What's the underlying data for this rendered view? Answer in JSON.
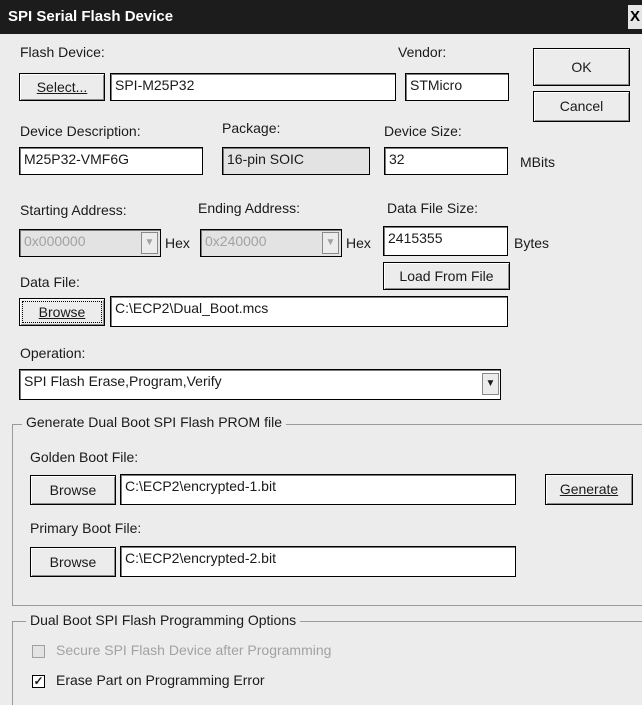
{
  "window": {
    "title": "SPI Serial Flash Device",
    "close_glyph": "X"
  },
  "buttons": {
    "ok": "OK",
    "cancel": "Cancel",
    "select": "Select...",
    "browse_data": "Browse",
    "load_from_file": "Load From File",
    "browse_golden": "Browse",
    "generate": "Generate",
    "browse_primary": "Browse"
  },
  "flash_device": {
    "label": "Flash Device:",
    "value": "SPI-M25P32"
  },
  "vendor": {
    "label": "Vendor:",
    "value": "STMicro"
  },
  "device_description": {
    "label": "Device Description:",
    "value": "M25P32-VMF6G"
  },
  "package": {
    "label": "Package:",
    "value": "16-pin SOIC"
  },
  "device_size": {
    "label": "Device Size:",
    "value": "32",
    "unit": "MBits"
  },
  "starting_address": {
    "label": "Starting Address:",
    "value": "0x000000",
    "suffix": "Hex"
  },
  "ending_address": {
    "label": "Ending Address:",
    "value": "0x240000",
    "suffix": "Hex"
  },
  "data_file_size": {
    "label": "Data File Size:",
    "value": "2415355",
    "unit": "Bytes"
  },
  "data_file": {
    "label": "Data File:",
    "value": "C:\\ECP2\\Dual_Boot.mcs"
  },
  "operation": {
    "label": "Operation:",
    "value": "SPI Flash Erase,Program,Verify"
  },
  "dual_boot_group": {
    "title": "Generate Dual Boot SPI Flash PROM file",
    "golden_label": "Golden Boot File:",
    "golden_value": "C:\\ECP2\\encrypted-1.bit",
    "primary_label": "Primary Boot File:",
    "primary_value": "C:\\ECP2\\encrypted-2.bit"
  },
  "options_group": {
    "title": "Dual Boot SPI Flash Programming Options",
    "secure_label": "Secure SPI Flash Device after Programming",
    "secure_checked": false,
    "erase_label": "Erase Part on Programming Error",
    "erase_checked": true
  },
  "icons": {
    "dropdown": "chevron-down-icon",
    "check": "checkmark-icon"
  }
}
